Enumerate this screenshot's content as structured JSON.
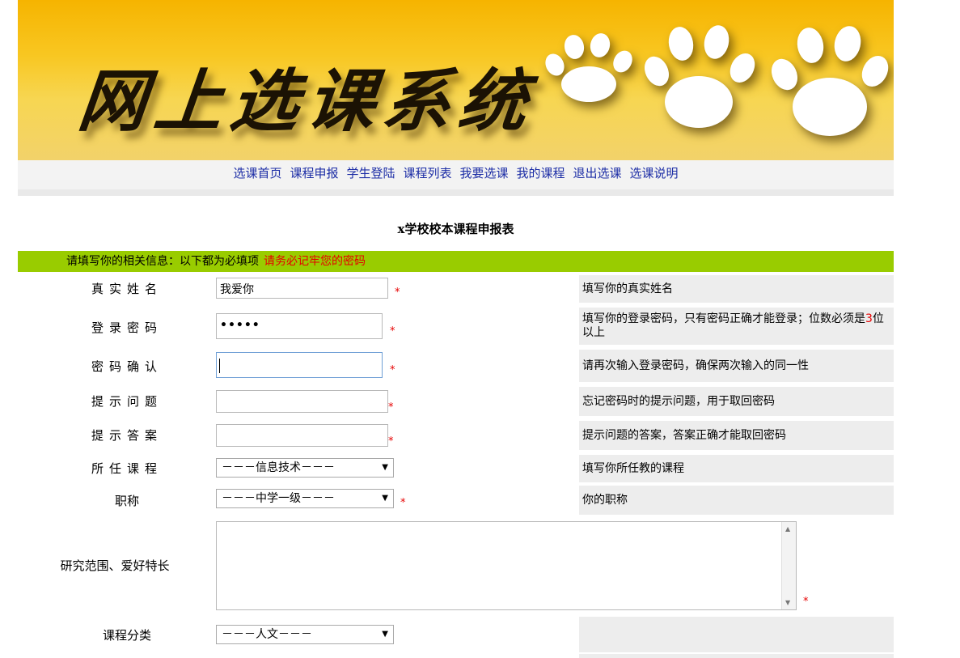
{
  "banner": {
    "title": "网上选课系统"
  },
  "nav": [
    "选课首页",
    "课程申报",
    "学生登陆",
    "课程列表",
    "我要选课",
    "我的课程",
    "退出选课",
    "选课说明"
  ],
  "form_title": "x学校校本课程申报表",
  "notice": {
    "text": "请填写你的相关信息：以下都为必填项",
    "warning": "请务必记牢您的密码"
  },
  "fields": {
    "name": {
      "label": "真实姓名",
      "value": "我爱你",
      "hint": "填写你的真实姓名"
    },
    "password": {
      "label": "登录密码",
      "value": "•••••",
      "hint_pre": "填写你的登录密码，只有密码正确才能登录；位数必须是",
      "hint_num": "3",
      "hint_post": "位以上"
    },
    "confirm": {
      "label": "密码确认",
      "value": "",
      "hint": "请再次输入登录密码，确保两次输入的同一性"
    },
    "question": {
      "label": "提示问题",
      "value": "",
      "hint": "忘记密码时的提示问题，用于取回密码"
    },
    "answer": {
      "label": "提示答案",
      "value": "",
      "hint": "提示问题的答案，答案正确才能取回密码"
    },
    "course": {
      "label": "所任课程",
      "selected": "－－－信息技术－－－",
      "hint": "填写你所任教的课程"
    },
    "title": {
      "label": "职称",
      "selected": "－－－中学一级－－－",
      "hint": "你的职称"
    },
    "research": {
      "label": "研究范围、爱好特长",
      "value": ""
    },
    "category": {
      "label": "课程分类",
      "selected": "－－－人文－－－",
      "hint": ""
    }
  },
  "required_mark": "*",
  "colors": {
    "notice_bg": "#99cc00",
    "nav_link": "#1d2ea6",
    "required": "#e60000"
  }
}
